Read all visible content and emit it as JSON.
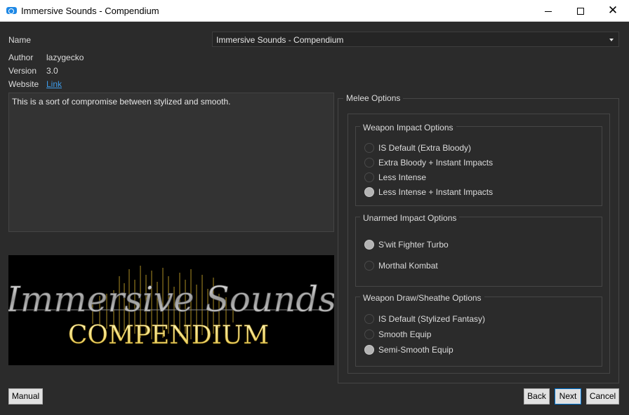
{
  "window": {
    "title": "Immersive Sounds - Compendium",
    "minimize_icon": "minimize-icon",
    "maximize_icon": "maximize-icon",
    "close_glyph": "✕"
  },
  "info": {
    "name_label": "Name",
    "name_value": "Immersive Sounds - Compendium",
    "author_label": "Author",
    "author_value": "lazygecko",
    "version_label": "Version",
    "version_value": "3.0",
    "website_label": "Website",
    "website_link": "Link",
    "description": "This is a sort of compromise between stylized and smooth."
  },
  "banner": {
    "line1": "Immersive Sounds",
    "line2": "COMPENDIUM"
  },
  "melee": {
    "title": "Melee Options",
    "groups": [
      {
        "title": "Weapon Impact Options",
        "options": [
          {
            "label": "IS Default (Extra Bloody)",
            "checked": false
          },
          {
            "label": "Extra Bloody + Instant Impacts",
            "checked": false
          },
          {
            "label": "Less Intense",
            "checked": false
          },
          {
            "label": "Less Intense + Instant Impacts",
            "checked": true
          }
        ]
      },
      {
        "title": "Unarmed Impact Options",
        "options": [
          {
            "label": "S'wit Fighter Turbo",
            "checked": true
          },
          {
            "label": "Morthal Kombat",
            "checked": false
          }
        ]
      },
      {
        "title": "Weapon Draw/Sheathe Options",
        "options": [
          {
            "label": "IS Default (Stylized Fantasy)",
            "checked": false
          },
          {
            "label": "Smooth Equip",
            "checked": false
          },
          {
            "label": "Semi-Smooth Equip",
            "checked": true
          }
        ]
      }
    ]
  },
  "buttons": {
    "manual": "Manual",
    "back": "Back",
    "next": "Next",
    "cancel": "Cancel"
  },
  "colors": {
    "background": "#2b2b2b",
    "link": "#3d9be9",
    "banner_silver": "#c8c8c8",
    "banner_gold": "#f2e27a"
  }
}
